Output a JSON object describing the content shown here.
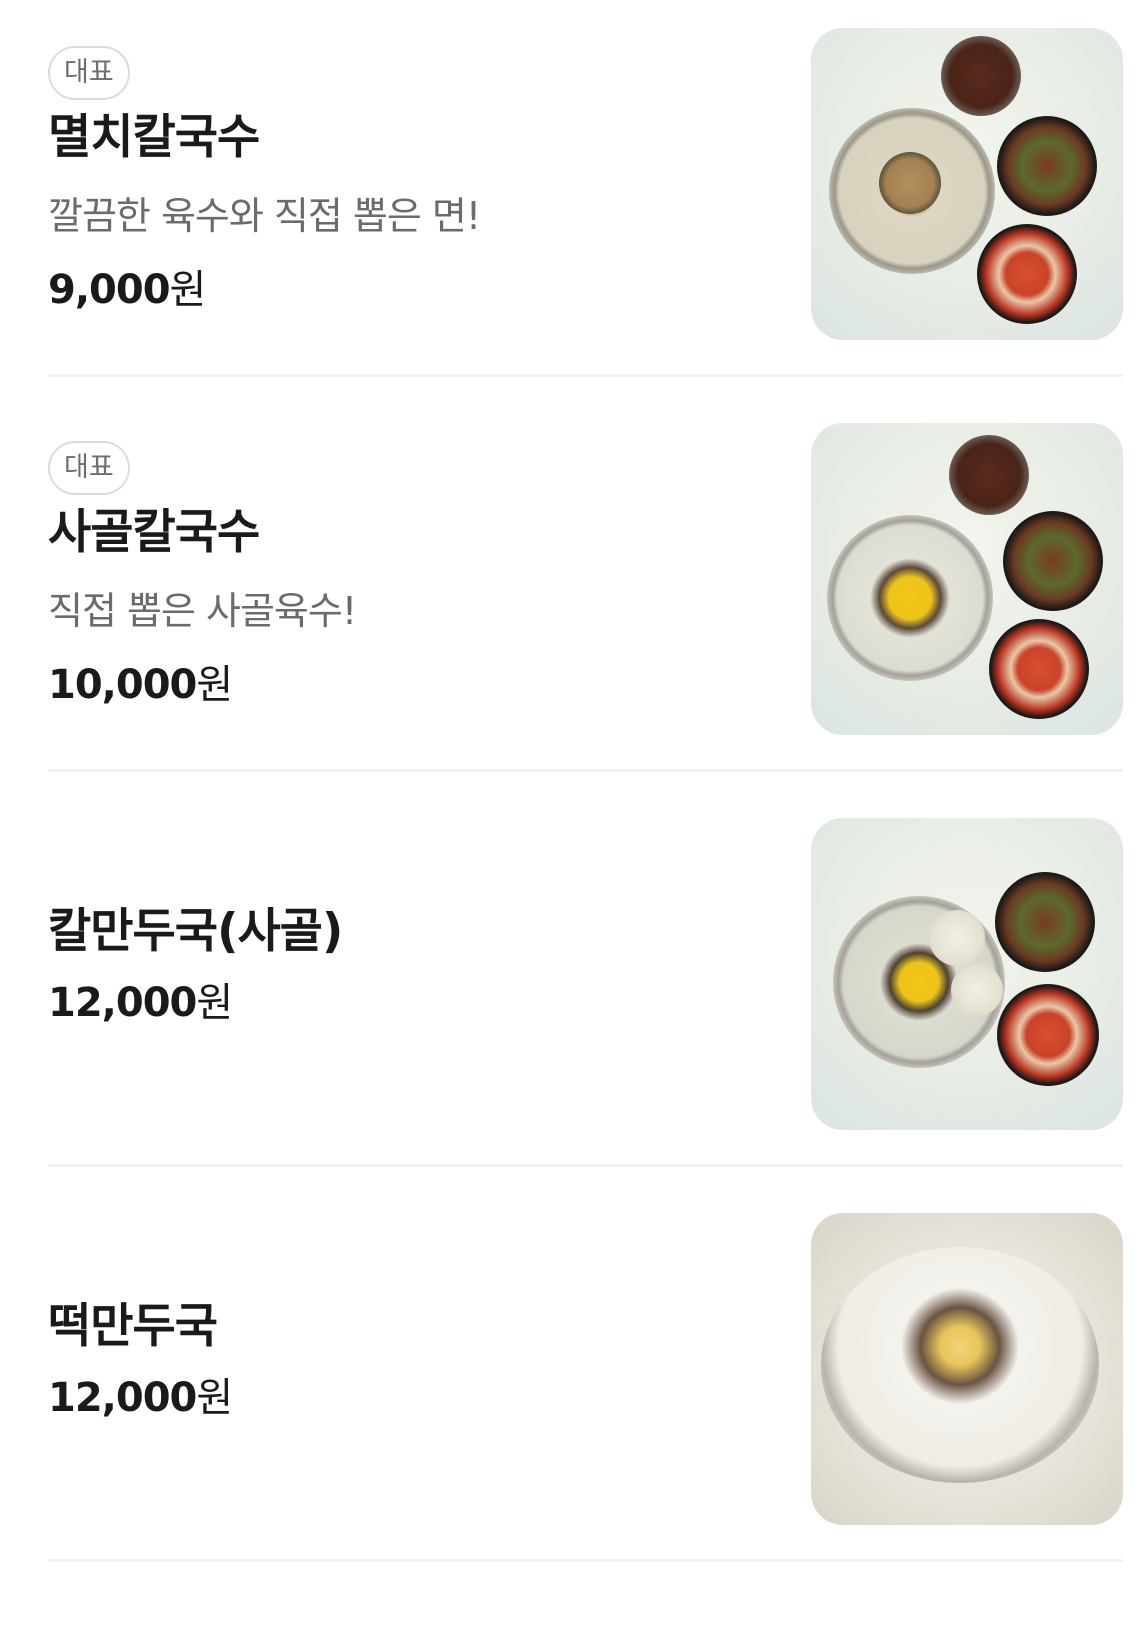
{
  "menu": {
    "items": [
      {
        "badge": "대표",
        "name": "멸치칼국수",
        "description": "깔끔한 육수와 직접 뽑은 면!",
        "price_number": "9,000",
        "price_unit": "원",
        "photo_icon": "anchovy-kalguksu-photo"
      },
      {
        "badge": "대표",
        "name": "사골칼국수",
        "description": "직접 뽑은 사골육수!",
        "price_number": "10,000",
        "price_unit": "원",
        "photo_icon": "sagol-kalguksu-photo"
      },
      {
        "name": "칼만두국(사골)",
        "price_number": "12,000",
        "price_unit": "원",
        "photo_icon": "kal-mandu-guk-photo"
      },
      {
        "name": "떡만두국",
        "price_number": "12,000",
        "price_unit": "원",
        "photo_icon": "tteok-mandu-guk-photo"
      }
    ]
  }
}
